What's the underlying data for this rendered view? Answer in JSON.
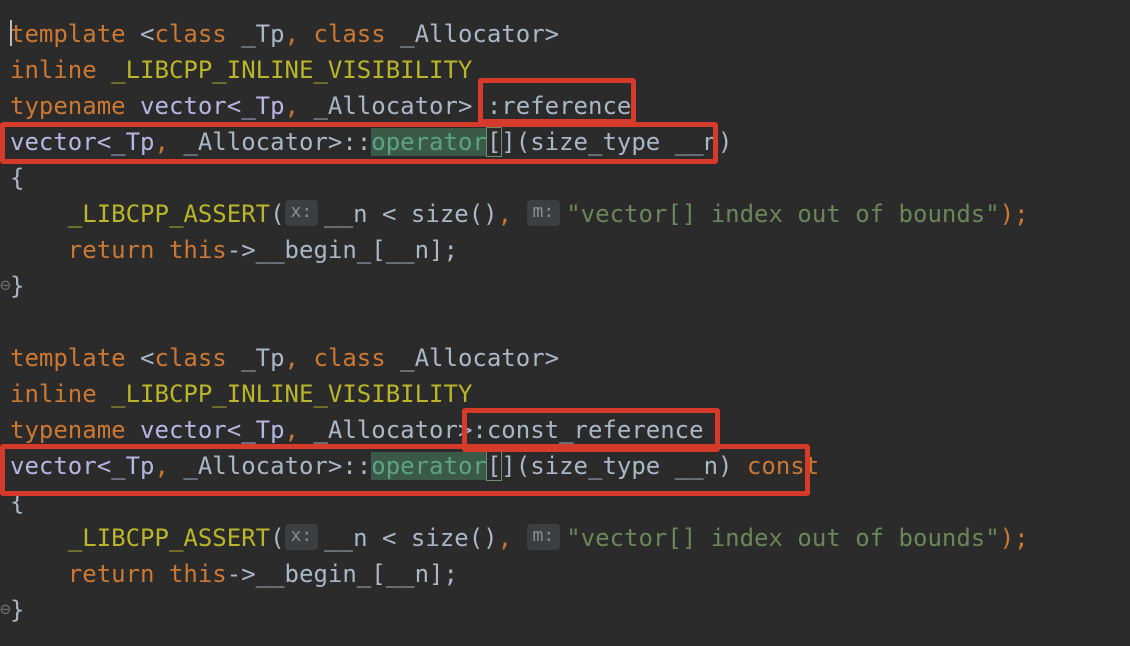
{
  "code": {
    "kw_template": "template",
    "lt_class": " <",
    "kw_class": "class",
    "tp_name": " _Tp",
    "comma": ",",
    "sp": " ",
    "alloc_name": " _Allocator",
    "gt": ">",
    "kw_inline": "inline",
    "macro_vis": " _LIBCPP_INLINE_VISIBILITY",
    "kw_typename": "typename",
    "vector_tpl": " vector<_Tp",
    "alloc_close": " _Allocator>::",
    "alloc_close_short": " _Allocator>",
    "reference": "reference",
    "const_reference": ":const_reference",
    "vector_tpl2": "vector<_Tp",
    "alloc_scope": " _Allocator>::",
    "operator": "operator",
    "bracket_open": "[",
    "bracket_rest": "](size_type __n)",
    "kw_const": " const",
    "brace_open": "{",
    "brace_close": "}",
    "indent": "    ",
    "assert_macro": "_LIBCPP_ASSERT",
    "paren_open": "(",
    "hint_x": "x:",
    "cond": "__n < size()",
    "hint_m": "m:",
    "message": "\"vector[] index out of bounds\"",
    "assert_end": ");",
    "kw_return": "return",
    "kw_this": " this",
    "begin_expr": "->__begin_[__n];"
  }
}
